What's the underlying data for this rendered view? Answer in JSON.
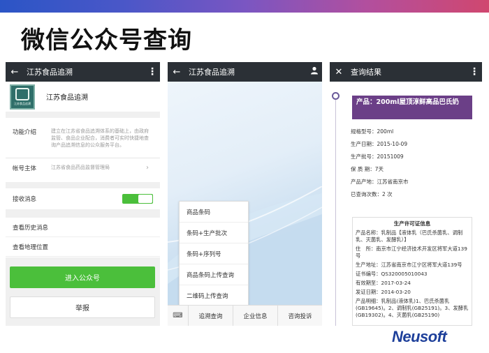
{
  "slide": {
    "title": "微信公众号查询",
    "brand": "Neusoft"
  },
  "phone1": {
    "appbar_title": "江苏食品追溯",
    "account_name": "江苏食品追溯",
    "logo_text": "江苏食品追溯",
    "intro_label": "功能介绍",
    "intro_text": "建立在江苏省食品追溯体系的基础上，由政府监管、食品企业配合，消费者可实时快捷地查询产品追溯信息的公众服务平台。",
    "owner_label": "帐号主体",
    "owner_value": "江苏省食品药品监督管理局",
    "receive_label": "接收消息",
    "history_label": "查看历史消息",
    "location_label": "查看地理位置",
    "enter_button": "进入公众号",
    "report_button": "举报"
  },
  "phone2": {
    "appbar_title": "江苏食品追溯",
    "menu": [
      "商品条码",
      "条码+生产批次",
      "条码+序列号",
      "商品条码上传查询",
      "二维码上传查询"
    ],
    "tabs": [
      "追溯查询",
      "企业信息",
      "咨询投诉"
    ]
  },
  "phone3": {
    "appbar_title": "查询结果",
    "product": "产品：200ml屋顶淳鲜高品巴氏奶",
    "fields": [
      "规格型号：200ml",
      "生产日期：2015-10-09",
      "生产批号：20151009",
      "保 质 期：7天",
      "产品产地：江苏省南京市",
      "已查询次数：2 次"
    ],
    "license_title": "生产许可证信息",
    "license_rows": [
      "产品名称：乳制品【液体乳（巴氏杀菌乳、调制乳、灭菌乳、发酵乳）】",
      "住　所：南京市江宁经济技术开发区将军大道139号",
      "生产地址：江苏省南京市江宁区将军大道139号",
      "证书编号：QS320005010043",
      "有效期至：2017-03-24",
      "发证日期：2014-03-20",
      "产品明细：乳制品(液体乳)1、巴氏杀菌乳(GB19645)。2、调制乳(GB25191)。3、发酵乳(GB19302)。4、灭菌乳(GB25190)"
    ]
  }
}
